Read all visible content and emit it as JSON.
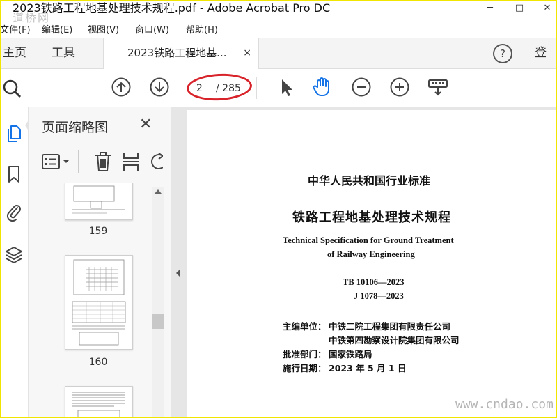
{
  "window": {
    "title": "2023铁路工程地基处理技术规程.pdf - Adobe Acrobat Pro DC",
    "watermark_top": "道桥网",
    "controls": [
      "─",
      "□",
      "✕"
    ]
  },
  "menu": [
    "文件(F)",
    "编辑(E)",
    "视图(V)",
    "窗口(W)",
    "帮助(H)"
  ],
  "tabs": {
    "home": "主页",
    "tools": "工具",
    "doc": "2023铁路工程地基...",
    "close": "×",
    "help": "?",
    "login": "登录"
  },
  "toolbar": {
    "page_value": "2",
    "page_total": "/ 285",
    "icons": [
      "search-icon",
      "arrow-up-circle-icon",
      "arrow-down-circle-icon",
      "select-cursor-icon",
      "hand-icon",
      "zoom-out-icon",
      "zoom-in-icon",
      "keyboard-icon"
    ]
  },
  "pane": {
    "title": "页面缩略图",
    "close": "✕",
    "thumbnails": [
      {
        "page": "159"
      },
      {
        "page": "160"
      },
      {
        "page": ""
      }
    ]
  },
  "document": {
    "standard": "中华人民共和国行业标准",
    "title_cn": "铁路工程地基处理技术规程",
    "title_en_1": "Technical Specification for Ground Treatment",
    "title_en_2": "of Railway Engineering",
    "code_1": "TB 10106—2023",
    "code_2": "J 1078—2023",
    "editor_label": "主编单位：",
    "editor_1": "中铁二院工程集团有限责任公司",
    "editor_2": "中铁第四勘察设计院集团有限公司",
    "approver_label": "批准部门：",
    "approver": "国家铁路局",
    "date_label": "施行日期：",
    "date": "2023 年 5 月 1 日"
  },
  "watermark_bottom": "www.cndao.com",
  "colors": {
    "accent": "#1473e6",
    "annotation": "#d8232a",
    "frame": "#f2e600"
  }
}
